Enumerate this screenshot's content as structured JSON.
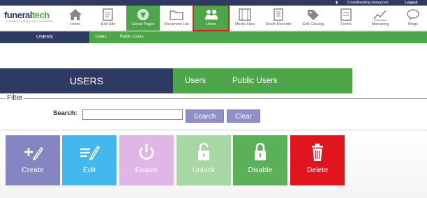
{
  "utilbar": {
    "crowdfunding_label": "Crowdfunding resources",
    "logout_label": "Logout"
  },
  "logo": {
    "brand_main": "funeral",
    "brand_accent": "tech",
    "tagline": "FUNERAL TECHNOLOGY PARTNERS"
  },
  "nav": [
    {
      "label": "Home",
      "icon": "home-icon"
    },
    {
      "label": "Edit Site",
      "icon": "edit-site-icon"
    },
    {
      "label": "Global Pages",
      "icon": "globe-icon"
    },
    {
      "label": "Document List",
      "icon": "folder-icon"
    },
    {
      "label": "Users",
      "icon": "users-icon"
    },
    {
      "label": "Media Files",
      "icon": "film-icon"
    },
    {
      "label": "Death Records",
      "icon": "records-icon"
    },
    {
      "label": "Edit Catalog",
      "icon": "tag-icon"
    },
    {
      "label": "Forms",
      "icon": "forms-icon"
    },
    {
      "label": "Marketing",
      "icon": "chart-icon"
    },
    {
      "label": "Blogs",
      "icon": "chat-icon"
    }
  ],
  "subnav": {
    "section": "USERS",
    "links": [
      "Users",
      "Public Users"
    ]
  },
  "page": {
    "title": "USERS",
    "tabs": [
      "Users",
      "Public Users"
    ]
  },
  "filter": {
    "legend": "Filter",
    "search_label": "Search:",
    "search_value": "",
    "search_button": "Search",
    "clear_button": "Clear"
  },
  "actions": [
    {
      "label": "Create",
      "color": "#8585c2",
      "icon": "create-icon"
    },
    {
      "label": "Edit",
      "color": "#45b7ef",
      "icon": "edit-icon"
    },
    {
      "label": "Enable",
      "color": "#dfb6e6",
      "icon": "power-icon"
    },
    {
      "label": "Unlock",
      "color": "#a8d7a6",
      "icon": "unlock-icon"
    },
    {
      "label": "Disable",
      "color": "#5bb05a",
      "icon": "lock-icon"
    },
    {
      "label": "Delete",
      "color": "#e01520",
      "icon": "trash-icon"
    }
  ],
  "colors": {
    "navy": "#2f3a63",
    "green": "#4da64a",
    "highlight": "#d42020"
  }
}
